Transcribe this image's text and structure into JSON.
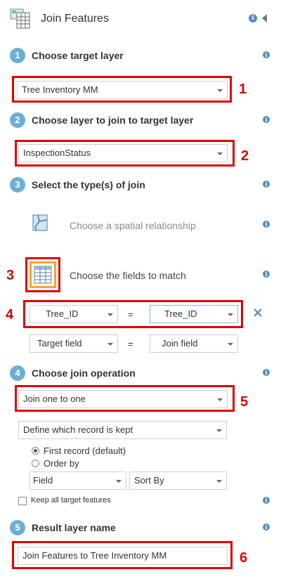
{
  "header": {
    "title": "Join Features",
    "icon": "join-features-tool-icon",
    "info_icon": "info-icon",
    "collapse_icon": "collapse-left-icon"
  },
  "steps": [
    {
      "number": "1",
      "title": "Choose target layer"
    },
    {
      "number": "2",
      "title": "Choose layer to join to target layer"
    },
    {
      "number": "3",
      "title": "Select the type(s) of join"
    },
    {
      "number": "4",
      "title": "Choose join operation"
    },
    {
      "number": "5",
      "title": "Result layer name"
    }
  ],
  "target_layer": {
    "value": "Tree Inventory MM"
  },
  "join_layer": {
    "value": "InspectionStatus"
  },
  "join_types": {
    "spatial_label": "Choose a spatial relationship",
    "fields_label": "Choose the fields to match"
  },
  "field_match": {
    "target_value": "Tree_ID",
    "operator": "=",
    "join_value": "Tree_ID",
    "remove_icon": "close-x-icon"
  },
  "field_match_new": {
    "target_placeholder": "Target field",
    "operator": "=",
    "join_placeholder": "Join field"
  },
  "join_operation": {
    "value": "Join one to one"
  },
  "record_kept": {
    "select_value": "Define which record is kept",
    "radio_first": "First record (default)",
    "radio_order": "Order by",
    "field_select": "Field",
    "sort_select": "Sort By"
  },
  "keep_all": {
    "label": "Keep all target features"
  },
  "result_name": {
    "value": "Join Features to Tree Inventory MM"
  },
  "annotations": [
    "1",
    "2",
    "3",
    "4",
    "5",
    "6"
  ],
  "colors": {
    "accent_circle": "#6baed6",
    "info_blue": "#4f8ec8",
    "annotation_red": "#e00000",
    "fields_icon_orange": "#f5a623"
  }
}
